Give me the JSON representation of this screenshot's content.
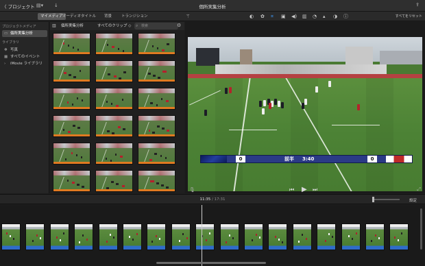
{
  "titlebar": {
    "back_label": "〈 プロジェクト",
    "title": "個所実集分析",
    "icons": [
      "media-library-icon",
      "download-icon",
      "share-icon"
    ]
  },
  "toolbar": {
    "tabs": [
      {
        "label": "マイメディア",
        "active": true
      },
      {
        "label": "オーディオ",
        "active": false
      },
      {
        "label": "タイトル",
        "active": false
      },
      {
        "label": "背景",
        "active": false
      },
      {
        "label": "トランジション",
        "active": false
      }
    ],
    "reset_all": "すべてをリセット",
    "tools": [
      "magic-wand-icon",
      "color-balance-icon",
      "color-correction-icon",
      "crop-icon",
      "stabilization-icon",
      "volume-icon",
      "equalizer-icon",
      "speed-icon",
      "noise-reduction-icon",
      "filter-icon",
      "info-icon"
    ],
    "active_tool": "crop-icon"
  },
  "sidebar": {
    "project_media_heading": "プロジェクトメディア",
    "project_item": "個所実集分析",
    "library_heading": "ライブラリ",
    "library_items": [
      {
        "label": "写真",
        "icon": "photos-icon"
      },
      {
        "label": "すべてのイベント",
        "icon": "events-icon"
      },
      {
        "label": "iMovie ライブラリ",
        "icon": "disclosure-icon"
      }
    ]
  },
  "browser": {
    "name": "個所実集分析",
    "filter": "すべてのクリップ ◇",
    "search_placeholder": "検索",
    "clip_count": 18
  },
  "viewer": {
    "score_left": "0",
    "period": "前半",
    "clock": "3:40",
    "score_right": "0",
    "controls": {
      "prev": "⏮",
      "play": "▶",
      "next": "⏭"
    }
  },
  "timeline": {
    "current_time": "11:35",
    "separator": " / ",
    "total_time": "17:31",
    "settings_label": "設定",
    "clip_count": 17
  },
  "colors": {
    "accent": "#3f9cff",
    "clip_bar": "#e07a21",
    "audio_bar": "#2f6cc9",
    "score_blue": "#2b3a86"
  }
}
